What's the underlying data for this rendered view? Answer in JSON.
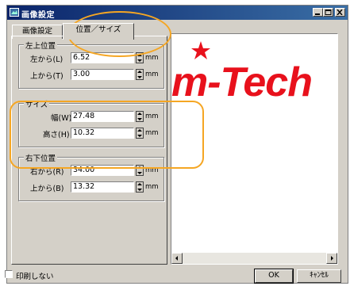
{
  "window": {
    "title": "画像設定",
    "controls": [
      "minimize-icon",
      "maximize-icon",
      "close-icon"
    ]
  },
  "tabs": [
    {
      "label": "画像設定",
      "active": false
    },
    {
      "label": "位置／サイズ",
      "active": true
    }
  ],
  "groups": {
    "top_left": {
      "title": "左上位置",
      "fields": [
        {
          "label": "左から(L)",
          "value": "6.52",
          "unit": "mm"
        },
        {
          "label": "上から(T)",
          "value": "3.00",
          "unit": "mm"
        }
      ]
    },
    "size": {
      "title": "サイズ",
      "fields": [
        {
          "label": "幅(W)",
          "value": "27.48",
          "unit": "mm"
        },
        {
          "label": "高さ(H)",
          "value": "10.32",
          "unit": "mm"
        }
      ]
    },
    "bottom_right": {
      "title": "右下位置",
      "fields": [
        {
          "label": "右から(R)",
          "value": "34.00",
          "unit": "mm"
        },
        {
          "label": "上から(B)",
          "value": "13.32",
          "unit": "mm"
        }
      ]
    }
  },
  "preview": {
    "logo_text": "m-Tech",
    "logo_color": "#e8111c"
  },
  "footer": {
    "no_print_label": "印刷しない",
    "no_print_checked": false,
    "ok_label": "OK",
    "cancel_label": "ｷｬﾝｾﾙ"
  },
  "annotations": {
    "color": "#f5a623"
  }
}
